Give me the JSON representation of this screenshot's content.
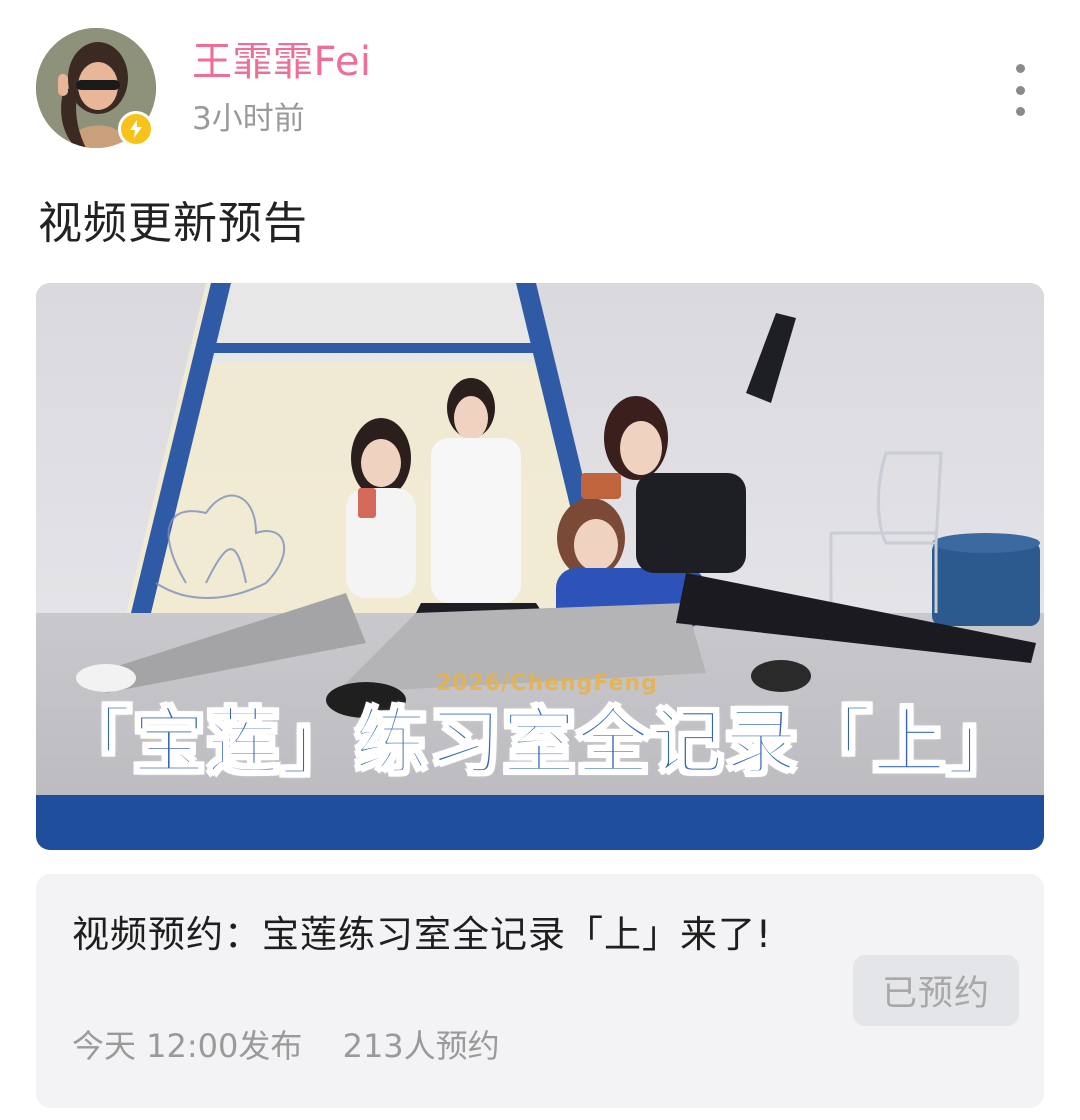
{
  "user": {
    "name": "王霏霏Fei",
    "time": "3小时前"
  },
  "post": {
    "text": "视频更新预告"
  },
  "media": {
    "overlay_sub": "2026/ChengFeng",
    "overlay_title": "「宝莲」练习室全记录「上」"
  },
  "card": {
    "title": "视频预约：宝莲练习室全记录「上」来了!",
    "publish_time": "今天 12:00发布",
    "reserve_count": "213人预约",
    "button_label": "已预约"
  },
  "colors": {
    "username": "#ee6f93",
    "verified_badge": "#f7c31a",
    "overlay_text": "#3563b8"
  },
  "icons": {
    "more": "more-vertical-icon",
    "verified": "lightning-icon"
  }
}
